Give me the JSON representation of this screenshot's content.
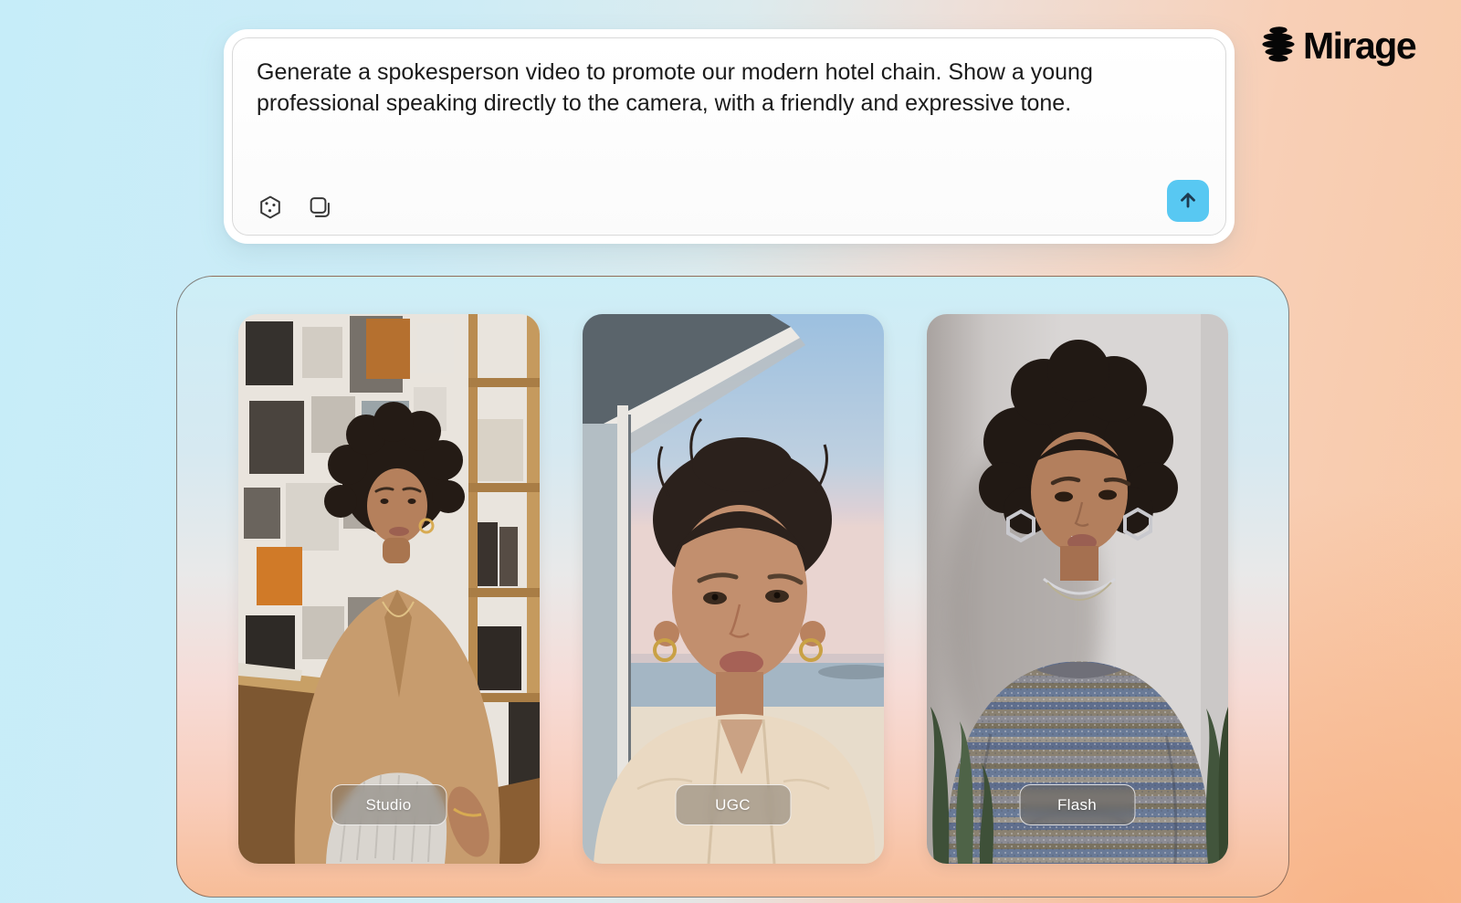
{
  "brand": {
    "name": "Mirage",
    "logo_icon": "mirage-logo-icon"
  },
  "prompt_box": {
    "text": "Generate a spokesperson video to promote our modern hotel chain. Show a young professional speaking directly to the camera, with a friendly and expressive tone.",
    "tools": [
      {
        "name": "dice-icon"
      },
      {
        "name": "copy-icon"
      }
    ],
    "submit": {
      "icon": "arrow-up-icon",
      "color": "#58c8f2"
    }
  },
  "results": {
    "cards": [
      {
        "label": "Studio"
      },
      {
        "label": "UGC"
      },
      {
        "label": "Flash"
      }
    ]
  },
  "colors": {
    "background_blue": "#c6edf9",
    "background_peach": "#f8c29c",
    "panel_top": "#cdeef7",
    "panel_bottom": "#f7bd98",
    "accent_blue": "#58c8f2",
    "arrow_dark": "#1d3a50",
    "text": "#1b1b1b"
  }
}
